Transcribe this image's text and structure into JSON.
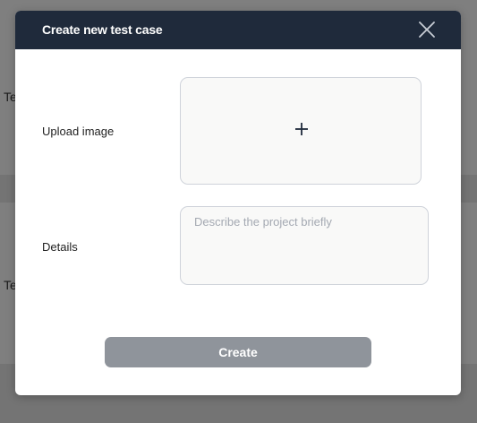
{
  "background": {
    "row_labels": [
      "Te",
      "Te"
    ]
  },
  "modal": {
    "title": "Create new test case",
    "close_icon": "close-icon",
    "upload": {
      "label": "Upload image",
      "icon": "plus-icon"
    },
    "details": {
      "label": "Details",
      "value": "",
      "placeholder": "Describe the project briefly"
    },
    "create_label": "Create"
  },
  "colors": {
    "header_bg": "#1f2a3b",
    "button_bg": "#8f949b",
    "field_bg": "#f9f9f8",
    "field_border": "#cfd3da"
  }
}
